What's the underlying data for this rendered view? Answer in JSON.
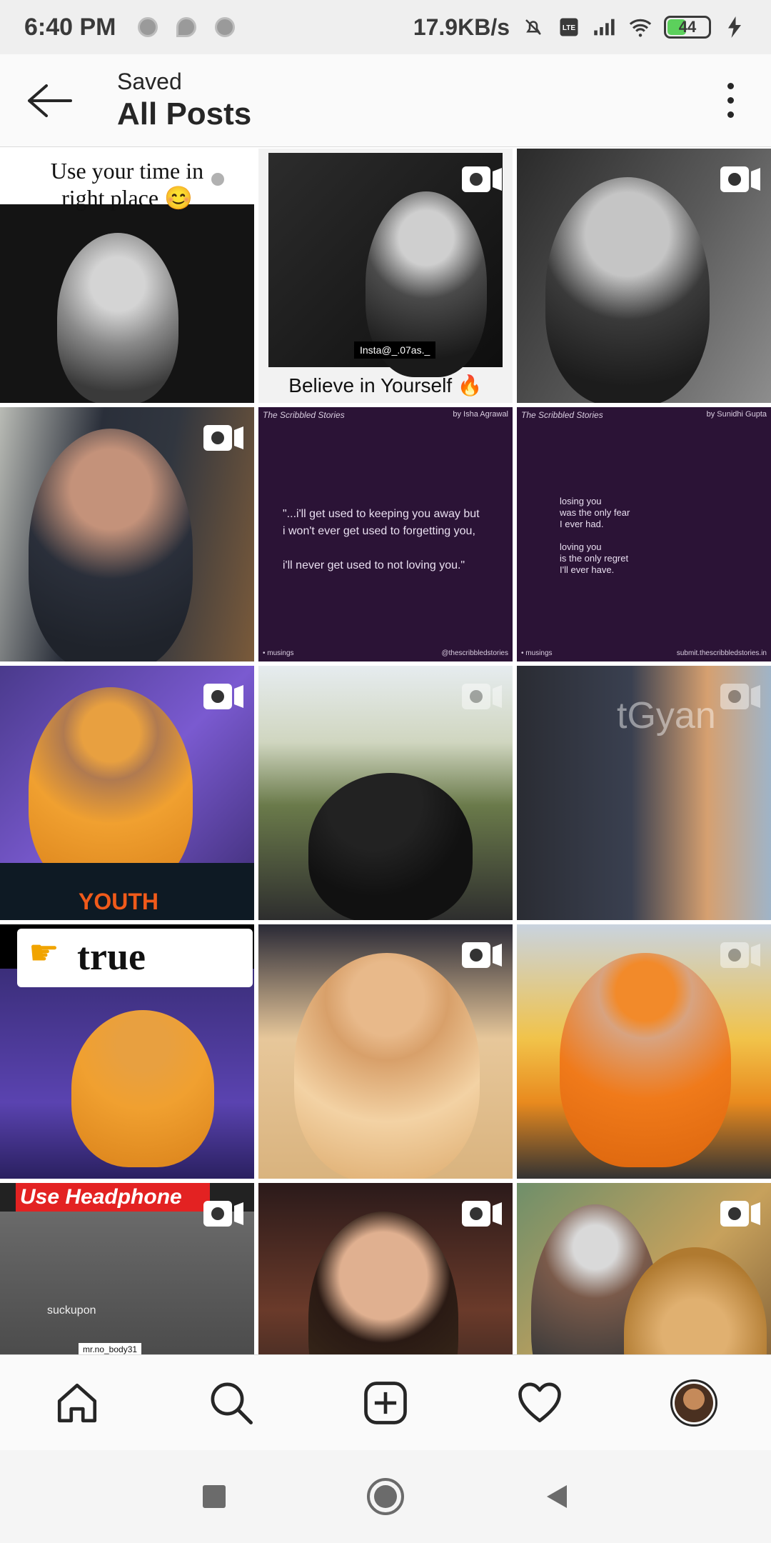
{
  "status_bar": {
    "time": "6:40 PM",
    "net_speed": "17.9KB/s",
    "network": "4G",
    "volte": "Vo LTE",
    "battery": "44",
    "icons": [
      "mute-bell-icon",
      "volte-icon",
      "signal-icon",
      "wifi-icon",
      "battery-icon",
      "charging-icon"
    ]
  },
  "header": {
    "subtitle": "Saved",
    "title": "All Posts",
    "icons": [
      "back-arrow-icon",
      "more-vert-icon"
    ]
  },
  "grid": {
    "post_1_caption_line1": "Use your time in",
    "post_1_caption_line2": "right place 😊",
    "post_2_tag": "Insta@_.07as._",
    "post_2_caption": "Believe in Yourself 🔥",
    "post_5": {
      "brand": "The Scribbled Stories",
      "author": "by Isha Agrawal",
      "body": "\"...i'll get used to keeping you away but\ni won't ever get used to forgetting you,\n\ni'll never get used to not loving you.\"",
      "footer_left": "• musings",
      "footer_right": "@thescribbledstories"
    },
    "post_6": {
      "brand": "The Scribbled Stories",
      "author": "by Sunidhi Gupta",
      "body": "losing you\nwas the only fear\nI ever had.\n\nloving you\nis the only regret\nI'll ever have.",
      "footer_left": "• musings",
      "footer_right": "submit.thescribbledstories.in"
    },
    "post_7_text": "YOUTH",
    "post_9_text": "tGyan",
    "post_10_banner": "true",
    "post_13_banner": "Use Headphone",
    "post_13_watermark": "suckupon",
    "post_13_user": "mr.no_body31",
    "video_icon": "video-camera-icon"
  },
  "bottom_nav": {
    "items": [
      "home-icon",
      "search-icon",
      "add-post-icon",
      "activity-heart-icon",
      "profile-avatar"
    ]
  },
  "system_nav": {
    "items": [
      "recents-square-icon",
      "home-circle-icon",
      "back-triangle-icon"
    ]
  }
}
